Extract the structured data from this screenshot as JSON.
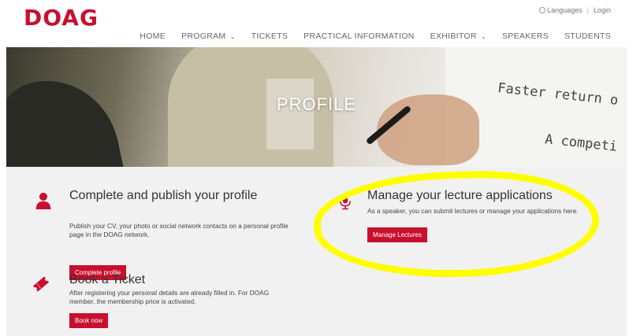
{
  "header": {
    "logo": "DOAG",
    "languages": "Languages",
    "login": "Login",
    "nav": [
      {
        "label": "HOME",
        "caret": ""
      },
      {
        "label": "PROGRAM",
        "caret": "⌄"
      },
      {
        "label": "TICKETS",
        "caret": ""
      },
      {
        "label": "PRACTICAL INFORMATION",
        "caret": ""
      },
      {
        "label": "EXHIBITOR",
        "caret": "⌄"
      },
      {
        "label": "SPEAKERS",
        "caret": ""
      },
      {
        "label": "STUDENTS",
        "caret": ""
      }
    ]
  },
  "hero": {
    "title": "PROFILE",
    "board_text_1": "Faster return o",
    "board_text_2": "A competi"
  },
  "cards": {
    "profile": {
      "icon": "user-icon",
      "title": "Complete and publish your profile",
      "text": "Publish your CV, your photo or social network contacts on a personal profile page in the DOAG network.",
      "button": "Complete profile"
    },
    "lectures": {
      "icon": "microphone-icon",
      "title": "Manage your lecture applications",
      "text": "As a speaker, you can submit lectures or manage your applications here.",
      "button": "Manage Lectures"
    },
    "ticket": {
      "icon": "ticket-icon",
      "title": "Book a Ticket",
      "text": "After registering your personal details are already filled in. For DOAG member, the membership price is activated.",
      "button": "Book now"
    }
  },
  "colors": {
    "brand": "#c8102e",
    "highlight": "#fffe00",
    "content_bg": "#f1f1f1"
  }
}
